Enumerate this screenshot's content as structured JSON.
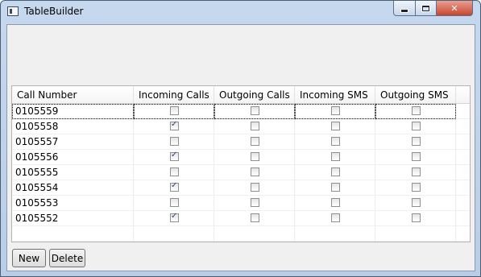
{
  "window": {
    "title": "TableBuilder",
    "close_glyph": "✕"
  },
  "table": {
    "columns": [
      "Call Number",
      "Incoming Calls",
      "Outgoing Calls",
      "Incoming SMS",
      "Outgoing SMS"
    ],
    "rows": [
      {
        "number": "0105559",
        "incoming_calls": false,
        "outgoing_calls": false,
        "incoming_sms": false,
        "outgoing_sms": false
      },
      {
        "number": "0105558",
        "incoming_calls": true,
        "outgoing_calls": false,
        "incoming_sms": false,
        "outgoing_sms": false
      },
      {
        "number": "0105557",
        "incoming_calls": false,
        "outgoing_calls": false,
        "incoming_sms": false,
        "outgoing_sms": false
      },
      {
        "number": "0105556",
        "incoming_calls": true,
        "outgoing_calls": false,
        "incoming_sms": false,
        "outgoing_sms": false
      },
      {
        "number": "0105555",
        "incoming_calls": false,
        "outgoing_calls": false,
        "incoming_sms": false,
        "outgoing_sms": false
      },
      {
        "number": "0105554",
        "incoming_calls": true,
        "outgoing_calls": false,
        "incoming_sms": false,
        "outgoing_sms": false
      },
      {
        "number": "0105553",
        "incoming_calls": false,
        "outgoing_calls": false,
        "incoming_sms": false,
        "outgoing_sms": false
      },
      {
        "number": "0105552",
        "incoming_calls": true,
        "outgoing_calls": false,
        "incoming_sms": false,
        "outgoing_sms": false
      }
    ]
  },
  "buttons": {
    "new_label": "New",
    "delete_label": "Delete"
  }
}
